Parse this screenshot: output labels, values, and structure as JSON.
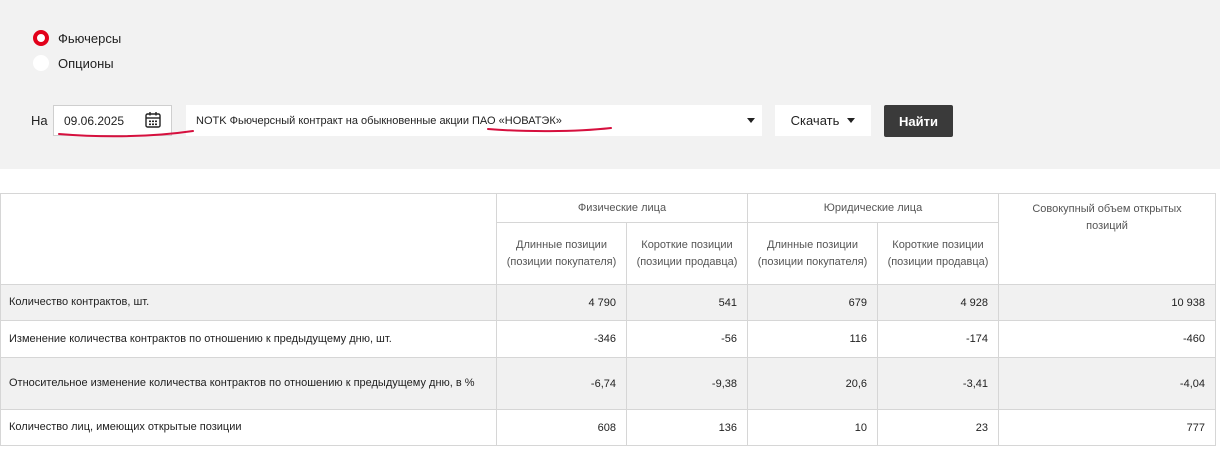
{
  "contract_type": {
    "options": [
      {
        "label": "Фьючерсы",
        "checked": true
      },
      {
        "label": "Опционы",
        "checked": false
      }
    ]
  },
  "filters": {
    "date_prefix": "На",
    "date_value": "09.06.2025",
    "contract_value": "NOTK Фьючерсный контракт на обыкновенные акции ПАО «НОВАТЭК»",
    "download_label": "Скачать",
    "find_label": "Найти"
  },
  "table": {
    "groups": {
      "individuals": "Физические лица",
      "legal_entities": "Юридические лица",
      "total": "Совокупный объем открытых позиций"
    },
    "subheaders": {
      "long": "Длинные позиции (позиции покупателя)",
      "short": "Короткие позиции (позиции продавца)"
    },
    "rows": [
      {
        "label": "Количество контрактов, шт.",
        "values": [
          "4 790",
          "541",
          "679",
          "4 928",
          "10 938"
        ]
      },
      {
        "label": "Изменение количества контрактов по отношению к предыдущему дню, шт.",
        "values": [
          "-346",
          "-56",
          "116",
          "-174",
          "-460"
        ]
      },
      {
        "label": "Относительное изменение количества контрактов по отношению к предыдущему дню, в %",
        "values": [
          "-6,74",
          "-9,38",
          "20,6",
          "-3,41",
          "-4,04"
        ]
      },
      {
        "label": "Количество лиц, имеющих открытые позиции",
        "values": [
          "608",
          "136",
          "10",
          "23",
          "777"
        ]
      }
    ]
  },
  "colors": {
    "accent": "#e2001a",
    "panel_bg": "#f2f2f2",
    "button_dark": "#3a3a3a",
    "row_shade": "#f1f1f1"
  }
}
